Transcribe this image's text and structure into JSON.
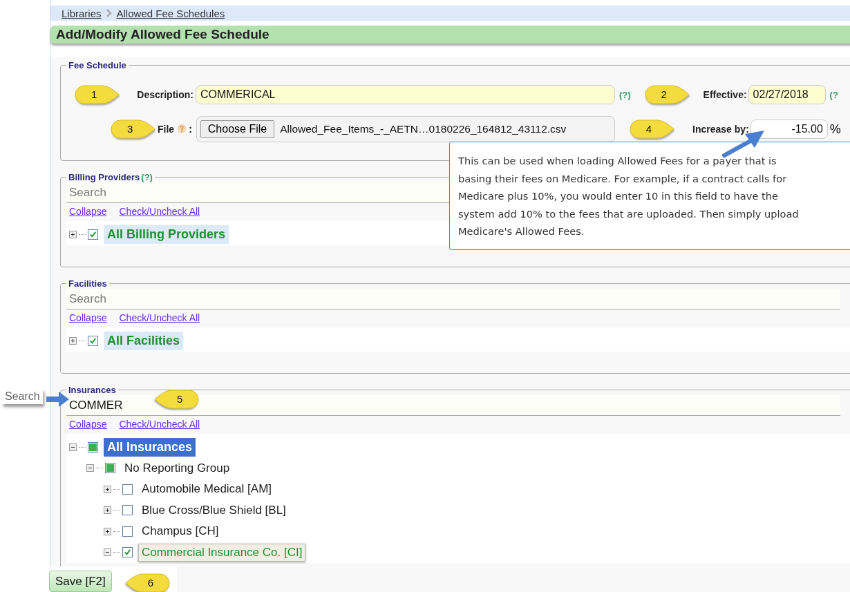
{
  "breadcrumb": [
    "Libraries",
    "Allowed Fee Schedules"
  ],
  "title": "Add/Modify Allowed Fee Schedule",
  "fee_schedule": {
    "legend": "Fee Schedule",
    "description": {
      "label": "Description:",
      "value": "COMMERICAL",
      "help": "(?)"
    },
    "effective": {
      "label": "Effective:",
      "value": "02/27/2018",
      "help": "(?"
    },
    "file": {
      "label": "File",
      "colon": ":",
      "button": "Choose File",
      "filename": "Allowed_Fee_Items_-_AETN…0180226_164812_43112.csv"
    },
    "increase": {
      "label": "Increase by:",
      "value": "-15.00",
      "unit": "%"
    }
  },
  "sections": [
    {
      "legend": "Billing Providers",
      "help": "(?)",
      "search": {
        "placeholder": "Search"
      },
      "links": [
        "Collapse",
        "Check/Uncheck All"
      ],
      "tree": [
        {
          "label": "All Billing Providers",
          "expanded": false,
          "checked": true,
          "partial": false,
          "selected": false,
          "hovered": false
        }
      ]
    },
    {
      "legend": "Facilities",
      "search": {
        "placeholder": "Search"
      },
      "links": [
        "Collapse",
        "Check/Uncheck All"
      ],
      "tree": [
        {
          "label": "All Facilities",
          "expanded": false,
          "checked": true,
          "partial": false,
          "selected": false,
          "hovered": false
        }
      ]
    },
    {
      "legend": "Insurances",
      "search": {
        "value": "COMMER"
      },
      "links": [
        "Collapse",
        "Check/Uncheck All"
      ],
      "tree": [
        {
          "label": "All Insurances",
          "expanded": true,
          "checked": false,
          "partial": true,
          "selected": true,
          "hovered": false,
          "children": [
            {
              "label": "No Reporting Group",
              "expanded": true,
              "checked": false,
              "partial": true,
              "selected": false,
              "hovered": false,
              "children": [
                {
                  "label": "Automobile Medical [AM]",
                  "expanded": false,
                  "checked": false,
                  "partial": false,
                  "selected": false,
                  "hovered": false
                },
                {
                  "label": "Blue Cross/Blue Shield [BL]",
                  "expanded": false,
                  "checked": false,
                  "partial": false,
                  "selected": false,
                  "hovered": false
                },
                {
                  "label": "Champus [CH]",
                  "expanded": false,
                  "checked": false,
                  "partial": false,
                  "selected": false,
                  "hovered": false
                },
                {
                  "label": "Commercial Insurance Co. [CI]",
                  "expanded": true,
                  "checked": true,
                  "partial": false,
                  "selected": false,
                  "hovered": true
                }
              ]
            }
          ]
        }
      ]
    }
  ],
  "tooltip": "This can be used when loading Allowed Fees for a payer that is\nbasing their fees on Medicare. For example, if a contract calls for\nMedicare plus 10%, you would enter 10 in this field to have the\nsystem add 10% to the fees that are uploaded. Then simply upload\nMedicare's Allowed Fees.",
  "save_button": "Save [F2]",
  "search_annotation": "Search",
  "callouts": [
    {
      "number": "1",
      "kind": "right"
    },
    {
      "number": "2",
      "kind": "right"
    },
    {
      "number": "3",
      "kind": "right"
    },
    {
      "number": "4",
      "kind": "right"
    },
    {
      "number": "5",
      "kind": "left"
    },
    {
      "number": "6",
      "kind": "left"
    }
  ]
}
